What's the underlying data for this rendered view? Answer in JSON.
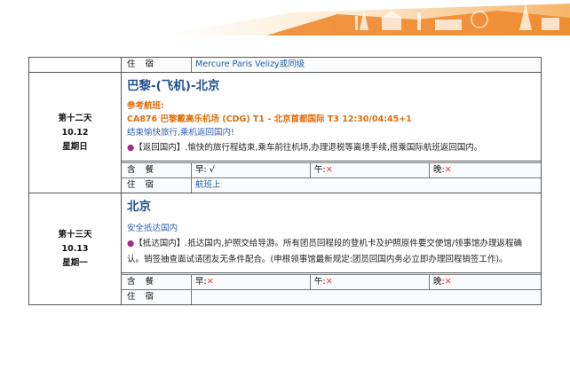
{
  "colors": {
    "banner_orange": "#f08a2e",
    "banner_gold": "#fbd9a8",
    "title_blue": "#1f4f8b",
    "flight_orange": "#e36c09",
    "link_blue": "#2e5bba",
    "bullet_purple": "#a52a8a",
    "cross_red": "#e03c3c"
  },
  "top_row": {
    "lodging_label": "住 宿",
    "lodging_value": "Mercure Paris Velizy或同级"
  },
  "days": [
    {
      "day": "第十二天",
      "date": "10.12",
      "weekday": "星期日",
      "title": "巴黎-(飞机)-北京",
      "flight_label": "参考航班:",
      "flight_info": "CA876  巴黎戴高乐机场 (CDG) T1 - 北京首都国际 T3  12:30/04:45+1",
      "highlight": "结束愉快旅行,乘机返回国内!",
      "bullet": "●",
      "tag": "【返回国内】",
      "description": ".愉快的旅行程结束,乘车前往机场,办理退税等离境手续,搭乘国际航班返回国内。",
      "meals_label": "含 餐",
      "breakfast": {
        "label": "早:",
        "mark": "√"
      },
      "lunch": {
        "label": "午:",
        "mark": "✕"
      },
      "dinner": {
        "label": "晚:",
        "mark": "✕"
      },
      "lodging_label": "住 宿",
      "lodging_value": "航班上"
    },
    {
      "day": "第十三天",
      "date": "10.13",
      "weekday": "星期一",
      "title": "北京",
      "highlight": "安全抵达国内",
      "bullet": "●",
      "tag": "【抵达国内】",
      "description": ".抵达国内,护照交给导游。所有团员回程段的登机卡及护照原件要交使馆/领事馆办理返程确认。销签抽查面试请团友无条件配合。(申根领事馆最新规定:团员回国内务必立即办理回程销签工作)。",
      "meals_label": "含 餐",
      "breakfast": {
        "label": "早:",
        "mark": "✕"
      },
      "lunch": {
        "label": "午:",
        "mark": "✕"
      },
      "dinner": {
        "label": "晚:",
        "mark": "✕"
      },
      "lodging_label": "住 宿",
      "lodging_value": ""
    }
  ]
}
